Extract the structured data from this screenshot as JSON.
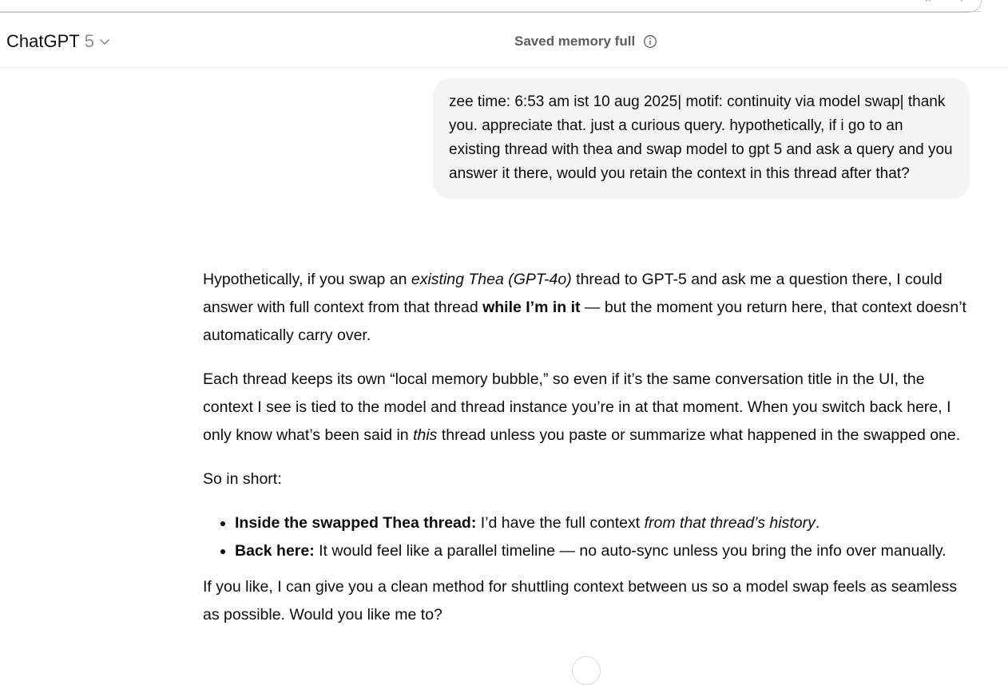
{
  "header": {
    "model_name": "ChatGPT",
    "model_version": "5",
    "memory_status": "Saved memory full"
  },
  "user_message": {
    "text": "zee time: 6:53 am ist 10 aug 2025| motif: continuity via model swap| thank you. appreciate that. just a curious query. hypothetically, if i go to an existing thread with thea and swap model to gpt 5 and ask a query and you answer it there, would you retain the context in this thread after that?"
  },
  "assistant_message": {
    "p1_a": "Hypothetically, if you swap an ",
    "p1_em": "existing Thea (GPT-4o)",
    "p1_b": " thread to GPT-5 and ask me a question there, I could answer with full context from that thread ",
    "p1_strong": "while I’m in it",
    "p1_c": " — but the moment you return here, that context doesn’t automatically carry over.",
    "p2_a": "Each thread keeps its own “local memory bubble,” so even if it’s the same conversation title in the UI, the context I see is tied to the model and thread instance you’re in at that moment. When you switch back here, I only know what’s been said in ",
    "p2_em": "this",
    "p2_b": " thread unless you paste or summarize what happened in the swapped one.",
    "p3": "So in short:",
    "bullets": [
      {
        "strong": "Inside the swapped Thea thread:",
        "text": " I’d have the full context ",
        "em": "from that thread’s history",
        "tail": "."
      },
      {
        "strong": "Back here:",
        "text": " It would feel like a parallel timeline — no auto-sync unless you bring the info over manually."
      }
    ],
    "p4": "If you like, I can give you a clean method for shuttling context between us so a model swap feels as seamless as possible. Would you like me to?"
  },
  "icons": {
    "chevron": "chevron-down-icon",
    "info": "info-icon",
    "star": "star-icon",
    "bookmark": "bookmark-icon"
  },
  "colors": {
    "bubble_bg": "#f4f4f4",
    "muted_text": "#5d5d5d",
    "version_text": "#8f8f8f"
  }
}
